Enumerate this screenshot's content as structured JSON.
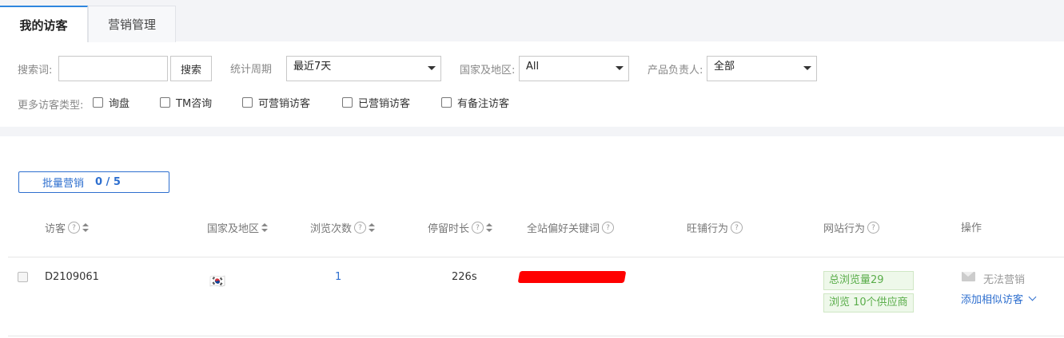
{
  "tabs": [
    {
      "label": "我的访客",
      "active": true
    },
    {
      "label": "营销管理",
      "active": false
    }
  ],
  "filters": {
    "search_label": "搜索词:",
    "search_value": "",
    "search_button": "搜索",
    "period_label": "统计周期",
    "period_value": "最近7天",
    "country_label": "国家及地区:",
    "country_value": "All",
    "owner_label": "产品负责人:",
    "owner_value": "全部",
    "more_types_label": "更多访客类型:",
    "checkboxes": [
      "询盘",
      "TM咨询",
      "可营销访客",
      "已营销访客",
      "有备注访客"
    ]
  },
  "batch": {
    "label": "批量营销",
    "count": "0 / 5"
  },
  "columns": {
    "visitor": "访客",
    "country": "国家及地区",
    "views": "浏览次数",
    "duration": "停留时长",
    "keywords": "全站偏好关键词",
    "wangpu": "旺铺行为",
    "site_behavior": "网站行为",
    "actions": "操作"
  },
  "rows": [
    {
      "visitor_id": "D2109061",
      "country_flag": "🇰🇷",
      "views": "1",
      "duration": "226s",
      "site_tags": [
        "总浏览量29",
        "浏览 10个供应商"
      ],
      "no_marketing": "无法营销",
      "add_similar": "添加相似访客"
    }
  ],
  "colors": {
    "accent": "#2e6fcf",
    "tag_green": "#5aad4a",
    "redaction": "#ff0000"
  }
}
